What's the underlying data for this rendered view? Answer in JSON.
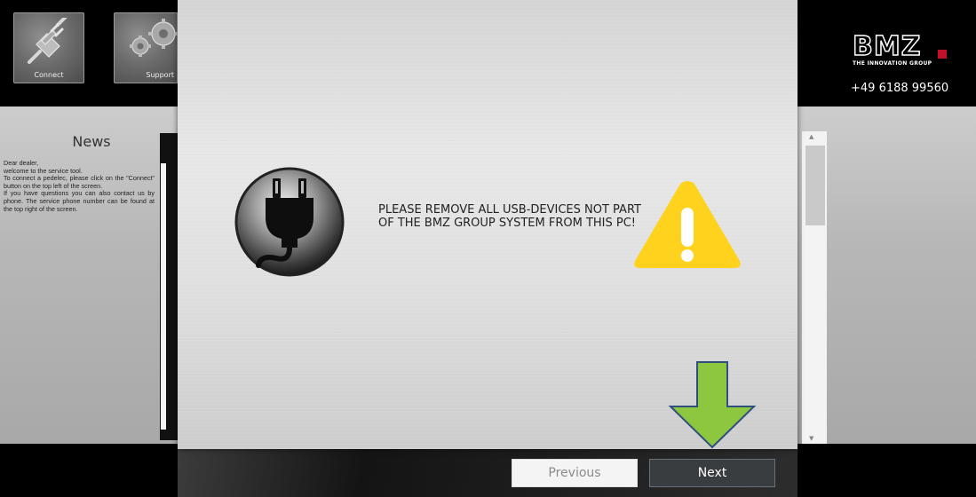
{
  "toolbar": {
    "connect_label": "Connect",
    "support_label": "Support"
  },
  "brand": {
    "logo_text": "BMZ",
    "tagline": "THE INNOVATION GROUP",
    "phone": "+49 6188 99560",
    "accent_color": "#c2102a"
  },
  "news": {
    "title": "News",
    "lines": [
      "Dear dealer,",
      "welcome to the service tool.",
      "To connect a pedelec, please click on the \"Connect\" button on the top left of the screen.",
      "If you have questions you can also contact us by phone. The service phone number can be found at the top right of the screen."
    ]
  },
  "dialog": {
    "message": "PLEASE REMOVE ALL USB-DEVICES NOT PART OF THE BMZ GROUP SYSTEM FROM THIS PC!",
    "icon_left": "plug-icon",
    "icon_right": "warning-icon",
    "warning_color": "#ffd21e",
    "previous_label": "Previous",
    "next_label": "Next",
    "pointer_arrow_color": "#8dc63f"
  }
}
